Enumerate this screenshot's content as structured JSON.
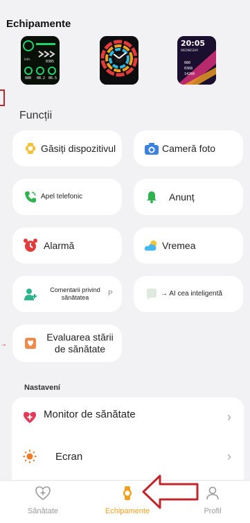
{
  "header": {
    "title": "Echipamente"
  },
  "watchfaces": [
    {
      "name": "watchface-1",
      "texts": [
        "100%",
        "0385",
        "080",
        "08.2",
        "06.5"
      ]
    },
    {
      "name": "watchface-2",
      "texts": []
    },
    {
      "name": "watchface-3",
      "texts": [
        "20:05",
        "WEDNESDAY",
        "080",
        "0368",
        "14260"
      ]
    }
  ],
  "functions": {
    "label": "Funcții",
    "items": [
      {
        "label": "Găsiți dispozitivul",
        "icon": "find-device-icon"
      },
      {
        "label": "Cameră foto",
        "icon": "camera-icon"
      },
      {
        "label": "Apel telefonic",
        "icon": "phone-icon"
      },
      {
        "label": "Anunț",
        "icon": "bell-icon"
      },
      {
        "label": "Alarmă",
        "icon": "alarm-icon"
      },
      {
        "label": "Vremea",
        "icon": "weather-icon"
      },
      {
        "label": "Comentarii privind sănătatea",
        "suffix": "P",
        "icon": "health-comment-icon"
      },
      {
        "label": "→ AI cea inteligentă",
        "icon": "ai-icon"
      },
      {
        "label": "Evaluarea stării de sănătate",
        "icon": "health-evaluation-icon"
      }
    ]
  },
  "settings": {
    "label": "Nastavení",
    "items": [
      {
        "label": "Monitor de sănătate",
        "icon": "heart-plus-icon"
      },
      {
        "label": "Ecran",
        "icon": "brightness-icon"
      }
    ]
  },
  "tabbar": {
    "tabs": [
      {
        "label": "Sănătate",
        "icon": "health-tab-icon",
        "active": false
      },
      {
        "label": "Echipamente",
        "icon": "watch-tab-icon",
        "active": true
      },
      {
        "label": "Profil",
        "icon": "profile-tab-icon",
        "active": false
      }
    ]
  },
  "colors": {
    "accent": "#f0a020",
    "annotation": "#c0262b",
    "background": "#f2f2f4"
  }
}
